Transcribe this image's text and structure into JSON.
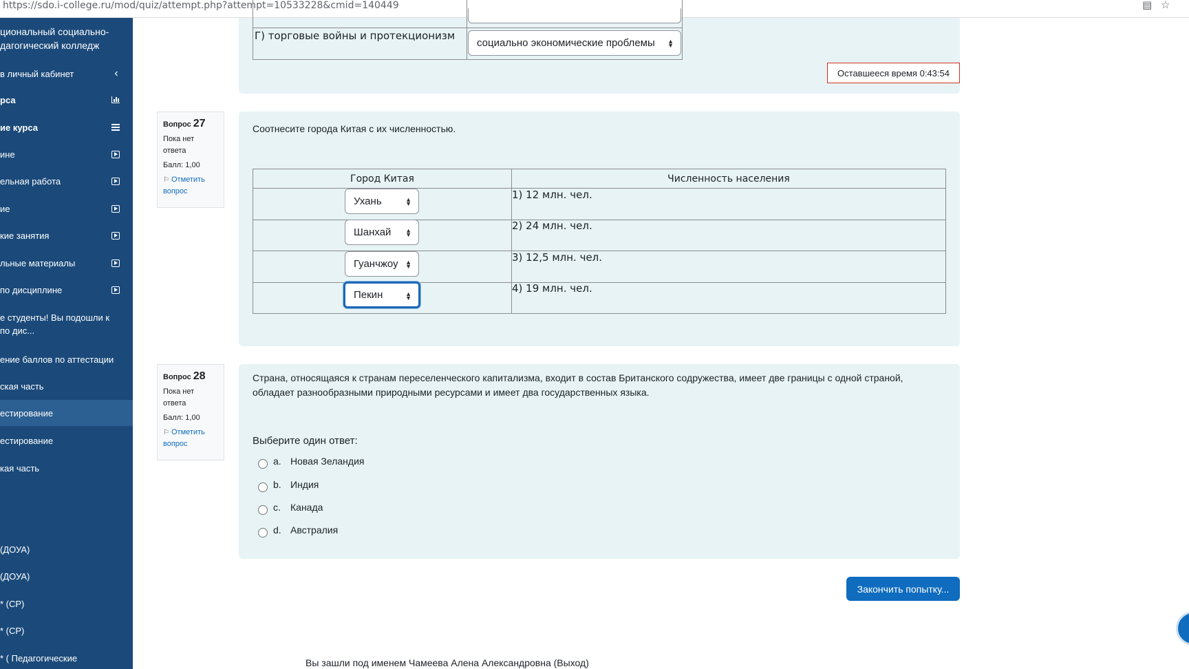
{
  "browser": {
    "url": "https://sdo.i-college.ru/mod/quiz/attempt.php?attempt=10533228&cmid=140449"
  },
  "drawer": {
    "college": "циональный социально-дагогический колледж",
    "items": [
      {
        "label": "в личный кабинет",
        "icon": "chevron-left-icon"
      },
      {
        "label": "рса",
        "icon": "bar-chart-icon"
      },
      {
        "label": "ие курса",
        "icon": "list-icon"
      },
      {
        "label": "ине",
        "icon": "play-icon"
      },
      {
        "label": "ельная работа",
        "icon": "play-icon"
      },
      {
        "label": "ие",
        "icon": "play-icon"
      },
      {
        "label": "кие занятия",
        "icon": "play-icon"
      },
      {
        "label": "льные материалы",
        "icon": "play-icon"
      },
      {
        "label": "по дисциплине",
        "icon": "play-icon"
      },
      {
        "label": "е студенты! Вы подошли к по дис...",
        "icon": ""
      },
      {
        "label": "ение баллов по аттестации",
        "icon": ""
      },
      {
        "label": "ская часть",
        "icon": ""
      },
      {
        "label": "естирование",
        "icon": ""
      },
      {
        "label": "естирование",
        "icon": ""
      },
      {
        "label": "кая часть",
        "icon": ""
      },
      {
        "label": "(ДОУА)",
        "icon": ""
      },
      {
        "label": "(ДОУА)",
        "icon": ""
      },
      {
        "label": "* (СР)",
        "icon": ""
      },
      {
        "label": "* (СР)",
        "icon": ""
      },
      {
        "label": "* ( Педагогические",
        "icon": ""
      }
    ]
  },
  "prev_question": {
    "row_label": "Г) торговые войны и протекционизм",
    "selected": "социально экономические проблемы"
  },
  "timer": {
    "text": "Оставшееся время 0:43:54"
  },
  "q27": {
    "label": "Вопрос",
    "number": "27",
    "state": "Пока нет ответа",
    "grade": "Балл: 1,00",
    "flag": "Отметить вопрос",
    "text": "Соотнесите города Китая с их численностью.",
    "col_city": "Город Китая",
    "col_pop": "Численность населения",
    "rows": [
      {
        "city": "Ухань",
        "pop": "1) 12 млн. чел."
      },
      {
        "city": "Шанхай",
        "pop": "2) 24 млн. чел."
      },
      {
        "city": "Гуанчжоу",
        "pop": "3) 12,5 млн. чел."
      },
      {
        "city": "Пекин",
        "pop": "4) 19 млн. чел."
      }
    ]
  },
  "q28": {
    "label": "Вопрос",
    "number": "28",
    "state": "Пока нет ответа",
    "grade": "Балл: 1,00",
    "flag": "Отметить вопрос",
    "text": "Страна, относящаяся к странам переселенческого капитализма, входит в состав Британского содружества, имеет две границы с одной страной, обладает разнообразными природными ресурсами и имеет два государственных языка.",
    "prompt": "Выберите один ответ:",
    "options": [
      {
        "letter": "a.",
        "text": "Новая Зеландия"
      },
      {
        "letter": "b.",
        "text": "Индия"
      },
      {
        "letter": "c.",
        "text": "Канада"
      },
      {
        "letter": "d.",
        "text": "Австралия"
      }
    ]
  },
  "finish_button": "Закончить попытку...",
  "footer": "Вы зашли под именем Чамеева Алена Александровна (Выход)",
  "colors": {
    "drawer": "#1b4a7a",
    "drawer_active": "#2c5f92",
    "panel": "#e7f3f5",
    "primary": "#0f6cbf",
    "timer_border": "#ca3120"
  }
}
